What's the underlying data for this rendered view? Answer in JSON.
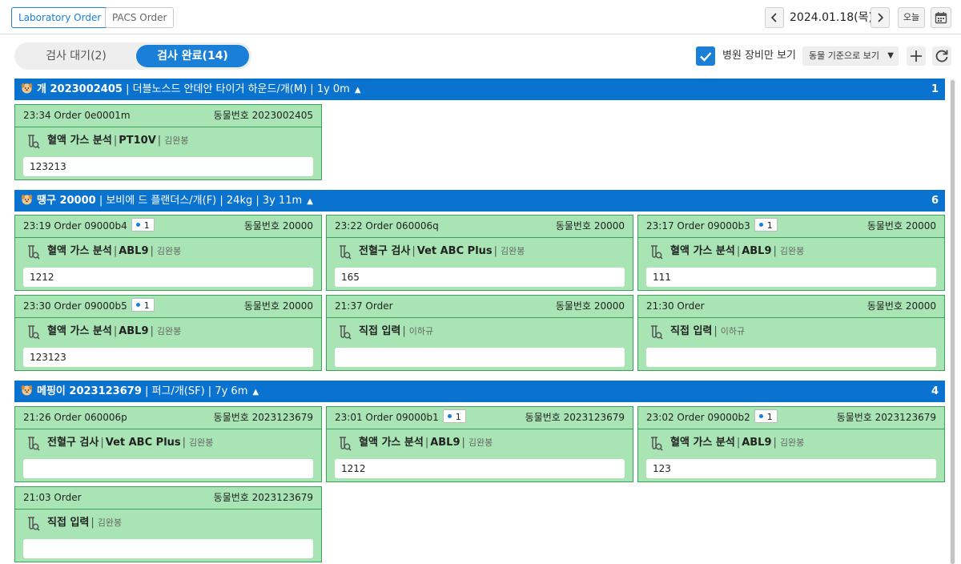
{
  "topbar": {
    "tabs": [
      "Laboratory Order",
      "PACS Order"
    ],
    "date": "2024.01.18(목)",
    "today_label": "오늘"
  },
  "toolbar": {
    "toggle_waiting": "검사 대기(2)",
    "toggle_done": "검사 완료(14)",
    "checkbox_label": "병원 장비만 보기",
    "view_select": "동물 기준으로 보기"
  },
  "colors": {
    "accent": "#1a7fd6",
    "group_header": "#0a73cf",
    "card_bg": "#a8e4b4",
    "card_border": "#3aa05a"
  },
  "icons": [
    "chevron-left-icon",
    "chevron-right-icon",
    "calendar-icon",
    "check-icon",
    "caret-down-icon",
    "plus-icon",
    "refresh-icon",
    "pet-avatar-icon",
    "caret-up-icon",
    "test-tube-search-icon"
  ],
  "groups": [
    {
      "name": "개 2023002405",
      "info": "더블노스드 안데안 타이거 하운드/개(M)",
      "age": "1y 0m",
      "count": "1",
      "cards": [
        {
          "time": "23:34",
          "order": "Order 0e0001m",
          "badge": "",
          "animal_no": "동물번호 2023002405",
          "exam": "혈액 가스 분석",
          "device": "PT10V",
          "staff": "김완봉",
          "value": "123213"
        }
      ]
    },
    {
      "name": "땡구 20000",
      "info": "보비에 드 플랜더스/개(F)",
      "weight": "24kg",
      "age": "3y 11m",
      "count": "6",
      "cards": [
        {
          "time": "23:19",
          "order": "Order 09000b4",
          "badge": "1",
          "animal_no": "동물번호 20000",
          "exam": "혈액 가스 분석",
          "device": "ABL9",
          "staff": "김완봉",
          "value": "1212"
        },
        {
          "time": "23:22",
          "order": "Order 060006q",
          "badge": "",
          "animal_no": "동물번호 20000",
          "exam": "전혈구 검사",
          "device": "Vet ABC Plus",
          "staff": "김완봉",
          "value": "165"
        },
        {
          "time": "23:17",
          "order": "Order 09000b3",
          "badge": "1",
          "animal_no": "동물번호 20000",
          "exam": "혈액 가스 분석",
          "device": "ABL9",
          "staff": "김완봉",
          "value": "111"
        },
        {
          "time": "23:30",
          "order": "Order 09000b5",
          "badge": "1",
          "animal_no": "동물번호 20000",
          "exam": "혈액 가스 분석",
          "device": "ABL9",
          "staff": "김완봉",
          "value": "123123"
        },
        {
          "time": "21:37",
          "order": "Order",
          "badge": "",
          "animal_no": "동물번호 20000",
          "exam": "직접 입력",
          "device": "",
          "staff": "이하규",
          "value": ""
        },
        {
          "time": "21:30",
          "order": "Order",
          "badge": "",
          "animal_no": "동물번호 20000",
          "exam": "직접 입력",
          "device": "",
          "staff": "이하규",
          "value": ""
        }
      ]
    },
    {
      "name": "메핑이 2023123679",
      "info": "퍼그/개(SF)",
      "age": "7y 6m",
      "count": "4",
      "cards": [
        {
          "time": "21:26",
          "order": "Order 060006p",
          "badge": "",
          "animal_no": "동물번호 2023123679",
          "exam": "전혈구 검사",
          "device": "Vet ABC Plus",
          "staff": "김완봉",
          "value": ""
        },
        {
          "time": "23:01",
          "order": "Order 09000b1",
          "badge": "1",
          "animal_no": "동물번호 2023123679",
          "exam": "혈액 가스 분석",
          "device": "ABL9",
          "staff": "김완봉",
          "value": "1212"
        },
        {
          "time": "23:02",
          "order": "Order 09000b2",
          "badge": "1",
          "animal_no": "동물번호 2023123679",
          "exam": "혈액 가스 분석",
          "device": "ABL9",
          "staff": "김완봉",
          "value": "123"
        },
        {
          "time": "21:03",
          "order": "Order",
          "badge": "",
          "animal_no": "동물번호 2023123679",
          "exam": "직접 입력",
          "device": "",
          "staff": "김완봉",
          "value": ""
        }
      ]
    }
  ]
}
